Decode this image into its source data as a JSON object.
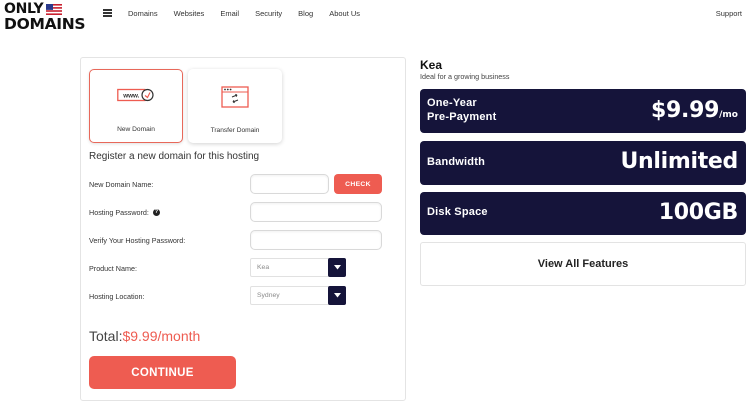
{
  "header": {
    "logo_line1": "ONLY",
    "logo_line2": "DOMAINS",
    "nav": [
      "Domains",
      "Websites",
      "Email",
      "Security",
      "Blog",
      "About Us"
    ],
    "support": "Support"
  },
  "colors": {
    "accent": "#ee5c51",
    "dark_panel": "#15143a"
  },
  "domain_options": {
    "new_domain": {
      "label": "New Domain",
      "icon": "www-domain-icon",
      "selected": true
    },
    "transfer_domain": {
      "label": "Transfer Domain",
      "icon": "transfer-browser-icon",
      "selected": false
    }
  },
  "form": {
    "title": "Register a new domain for this hosting",
    "new_domain_name_label": "New Domain Name:",
    "new_domain_name_value": "",
    "check_button": "CHECK",
    "hosting_password_label": "Hosting Password:",
    "verify_password_label": "Verify Your Hosting Password:",
    "product_name_label": "Product Name:",
    "product_name_value": "Kea",
    "hosting_location_label": "Hosting Location:",
    "hosting_location_value": "Sydney",
    "total_label": "Total:",
    "total_amount": "$9.99/month",
    "continue_button": "CONTINUE"
  },
  "plan": {
    "name": "Kea",
    "subtitle": "Ideal for a growing business",
    "prepayment_label_line1": "One-Year",
    "prepayment_label_line2": "Pre-Payment",
    "price": "$9.99",
    "price_unit": "/mo",
    "bandwidth_label": "Bandwidth",
    "bandwidth_value": "Unlimited",
    "disk_label": "Disk Space",
    "disk_value": "100GB",
    "view_all": "View All Features"
  }
}
